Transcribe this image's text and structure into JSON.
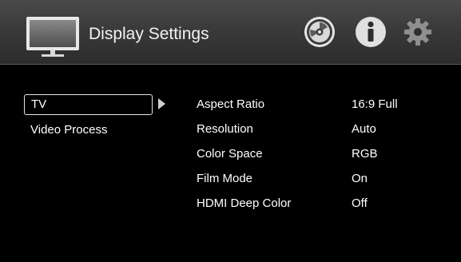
{
  "header": {
    "title": "Display Settings",
    "icons": [
      "tv-icon",
      "disc-icon",
      "info-icon",
      "gear-icon"
    ]
  },
  "categories": [
    {
      "label": "TV",
      "selected": true
    },
    {
      "label": "Video Process",
      "selected": false
    }
  ],
  "settings": [
    {
      "name": "Aspect Ratio",
      "value": "16:9 Full"
    },
    {
      "name": "Resolution",
      "value": "Auto"
    },
    {
      "name": "Color Space",
      "value": "RGB"
    },
    {
      "name": "Film Mode",
      "value": "On"
    },
    {
      "name": "HDMI Deep Color",
      "value": "Off"
    }
  ],
  "colors": {
    "background": "#000000",
    "header_top": "#4a4a4a",
    "header_bottom": "#2c2c2c",
    "text": "#ffffff",
    "icon_fill": "#e0e0e0"
  }
}
